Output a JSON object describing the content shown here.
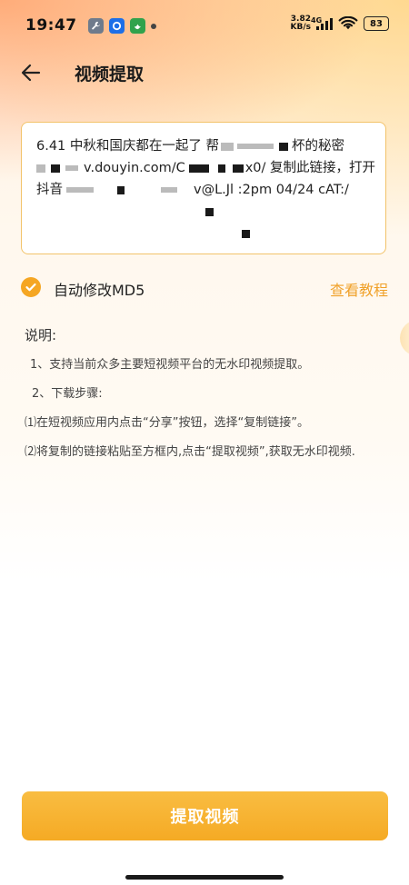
{
  "status_bar": {
    "time": "19:47",
    "net_speed_value": "3.82",
    "net_speed_unit": "KB/s",
    "network_gen": "4G",
    "battery": "83"
  },
  "header": {
    "title": "视频提取"
  },
  "link_box": {
    "line1_a": "6.41 中秋和国庆都在一起了 帮",
    "line1_b": "杯的秘密",
    "line2_a": "v.douyin.com/C",
    "line2_b": "x0/ 复制此链接，打开",
    "line3_a": "抖音",
    "line3_b": "v@L.Jl :2pm 04/24 cAT:/"
  },
  "md5": {
    "label": "自动修改MD5",
    "checked": true,
    "tutorial_label": "查看教程"
  },
  "instructions": {
    "title": "说明:",
    "line1": "1、支持当前众多主要短视频平台的无水印视频提取。",
    "line2": "2、下载步骤:",
    "step1": "⑴在短视频应用内点击“分享”按钮，选择“复制链接”。",
    "step2": "⑵将复制的链接粘贴至方框内,点击“提取视频”,获取无水印视频."
  },
  "extract_button": {
    "label": "提取视频"
  },
  "colors": {
    "accent": "#f5a623",
    "accent_text": "#f0a12a",
    "box_border": "#f2c36a"
  },
  "icons": [
    "back-arrow-icon",
    "check-icon",
    "wrench-icon",
    "circle-app-icon",
    "bird-app-icon",
    "signal-icon",
    "wifi-icon",
    "battery-icon"
  ]
}
